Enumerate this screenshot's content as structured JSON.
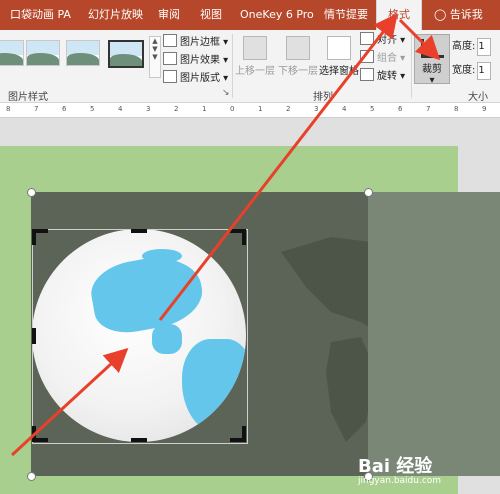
{
  "tabs": [
    {
      "label": "口袋动画 PA",
      "active": false
    },
    {
      "label": "幻灯片放映",
      "active": false
    },
    {
      "label": "审阅",
      "active": false
    },
    {
      "label": "视图",
      "active": false
    },
    {
      "label": "OneKey 6 Pro",
      "active": false
    },
    {
      "label": "情节提要",
      "active": false
    },
    {
      "label": "格式",
      "active": true
    }
  ],
  "tell_me": "告诉我",
  "ribbon": {
    "picture_styles_label": "图片样式",
    "border_label": "图片边框",
    "effects_label": "图片效果",
    "layout_label": "图片版式",
    "bring_forward_label": "上移一层",
    "send_backward_label": "下移一层",
    "selection_pane_label": "选择窗格",
    "align_label": "对齐",
    "group_label": "组合",
    "rotate_label": "旋转",
    "arrange_label": "排列",
    "crop_label": "裁剪",
    "height_label": "高度:",
    "width_label": "宽度:",
    "height_value": "1",
    "width_value": "1",
    "size_label": "大小"
  },
  "watermark": {
    "text": "Bai 经验",
    "sub": "jingyan.baidu.com"
  },
  "colors": {
    "accent": "#b7472a",
    "slide_bg": "#a8cf8e",
    "photo": "#5b6457",
    "ocean_land": "#63c6ea",
    "arrow": "#e8402a"
  }
}
